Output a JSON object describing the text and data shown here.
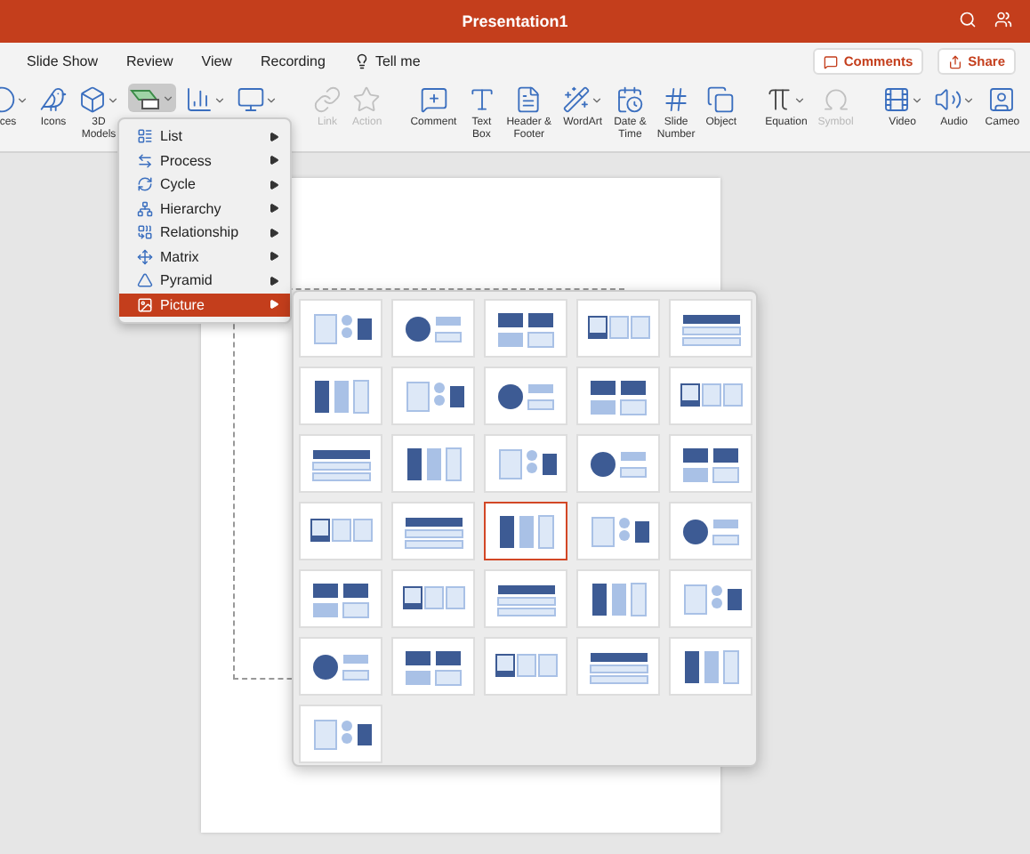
{
  "window": {
    "title": "Presentation1"
  },
  "menu_tabs": [
    {
      "label": "Slide Show"
    },
    {
      "label": "Review"
    },
    {
      "label": "View"
    },
    {
      "label": "Recording"
    },
    {
      "label": "Tell me",
      "kind": "search"
    }
  ],
  "header_buttons": [
    {
      "label": "Comments"
    },
    {
      "label": "Share"
    }
  ],
  "ribbon": [
    {
      "label": "ces",
      "disabled": false,
      "selected": false,
      "dropdown": true
    },
    {
      "label": "Icons",
      "disabled": false,
      "selected": false,
      "dropdown": false
    },
    {
      "label": "3D\nModels",
      "disabled": false,
      "selected": false,
      "dropdown": true
    },
    {
      "disabled": false,
      "selected": true,
      "dropdown": true
    },
    {
      "disabled": false,
      "selected": false,
      "dropdown": true
    },
    {
      "disabled": false,
      "selected": false,
      "dropdown": true
    },
    {
      "label": "Link",
      "disabled": true,
      "selected": false,
      "dropdown": false
    },
    {
      "label": "Action",
      "disabled": true,
      "selected": false,
      "dropdown": false
    },
    {
      "label": "Comment",
      "disabled": false,
      "selected": false,
      "dropdown": false
    },
    {
      "label": "Text\nBox",
      "disabled": false,
      "selected": false,
      "dropdown": false
    },
    {
      "label": "Header &\nFooter",
      "disabled": false,
      "selected": false,
      "dropdown": false
    },
    {
      "label": "WordArt",
      "disabled": false,
      "selected": false,
      "dropdown": true
    },
    {
      "label": "Date &\nTime",
      "disabled": false,
      "selected": false,
      "dropdown": false
    },
    {
      "label": "Slide\nNumber",
      "disabled": false,
      "selected": false,
      "dropdown": false
    },
    {
      "label": "Object",
      "disabled": false,
      "selected": false,
      "dropdown": false
    },
    {
      "label": "Equation",
      "disabled": false,
      "selected": false,
      "dropdown": true
    },
    {
      "label": "Symbol",
      "disabled": true,
      "selected": false,
      "dropdown": false
    },
    {
      "label": "Video",
      "disabled": false,
      "selected": false,
      "dropdown": true
    },
    {
      "label": "Audio",
      "disabled": false,
      "selected": false,
      "dropdown": true
    },
    {
      "label": "Cameo",
      "disabled": false,
      "selected": false,
      "dropdown": false
    }
  ],
  "smartart_menu": [
    {
      "label": "List",
      "selected": false
    },
    {
      "label": "Process",
      "selected": false
    },
    {
      "label": "Cycle",
      "selected": false
    },
    {
      "label": "Hierarchy",
      "selected": false
    },
    {
      "label": "Relationship",
      "selected": false
    },
    {
      "label": "Matrix",
      "selected": false
    },
    {
      "label": "Pyramid",
      "selected": false
    },
    {
      "label": "Picture",
      "selected": true
    }
  ],
  "picture_layouts": [
    {
      "selected": false
    },
    {
      "selected": false
    },
    {
      "selected": false
    },
    {
      "selected": false
    },
    {
      "selected": false
    },
    {
      "selected": false
    },
    {
      "selected": false
    },
    {
      "selected": false
    },
    {
      "selected": false
    },
    {
      "selected": false
    },
    {
      "selected": false
    },
    {
      "selected": false
    },
    {
      "selected": false
    },
    {
      "selected": false
    },
    {
      "selected": false
    },
    {
      "selected": false
    },
    {
      "selected": false
    },
    {
      "selected": true
    },
    {
      "selected": false
    },
    {
      "selected": false
    },
    {
      "selected": false
    },
    {
      "selected": false
    },
    {
      "selected": false
    },
    {
      "selected": false
    },
    {
      "selected": false
    },
    {
      "selected": false
    },
    {
      "selected": false
    },
    {
      "selected": false
    },
    {
      "selected": false
    },
    {
      "selected": false
    },
    {
      "selected": false
    }
  ]
}
